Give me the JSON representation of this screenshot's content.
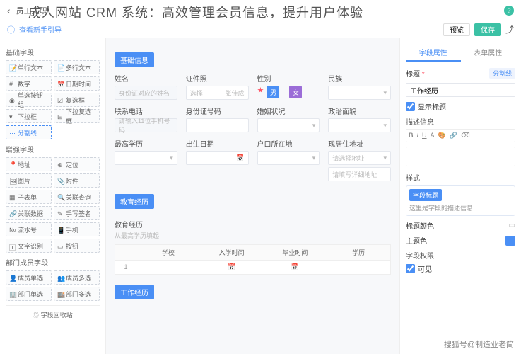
{
  "header": {
    "back_label": "员工入职",
    "title_overlay": "成人网站 CRM 系统：高效管理会员信息，提升用户体验"
  },
  "subbar": {
    "hint": "查看新手引导",
    "btn_view": "预览",
    "btn_save": "保存"
  },
  "leftPanel": {
    "basic": {
      "title": "基础字段",
      "items": [
        "单行文本",
        "多行文本",
        "数字",
        "日期时间",
        "单选按钮组",
        "复选框",
        "下拉框",
        "下拉复选框",
        "分割线"
      ]
    },
    "enhance": {
      "title": "增强字段",
      "items": [
        "地址",
        "定位",
        "图片",
        "附件",
        "子表单",
        "关联查询",
        "关联数据",
        "手写签名",
        "流水号",
        "手机",
        "文字识别",
        "按钮"
      ]
    },
    "dept": {
      "title": "部门成员字段",
      "items": [
        "成员单选",
        "成员多选",
        "部门单选",
        "部门多选"
      ]
    },
    "recycle": "字段回收站"
  },
  "center": {
    "sec_basic": "基础信息",
    "fields": {
      "name": {
        "label": "姓名",
        "ph": "身份证对应的姓名"
      },
      "cert": {
        "label": "证件照",
        "ph": "选择",
        "ph2": "张佳成"
      },
      "gender": {
        "label": "性别",
        "male": "男",
        "female": "女"
      },
      "nation": {
        "label": "民族"
      },
      "phone": {
        "label": "联系电话",
        "ph": "请输入11位手机号码"
      },
      "idnum": {
        "label": "身份证号码"
      },
      "marriage": {
        "label": "婚姻状况"
      },
      "politics": {
        "label": "政治面貌"
      },
      "edu": {
        "label": "最高学历"
      },
      "birth": {
        "label": "出生日期"
      },
      "hukou": {
        "label": "户口所在地"
      },
      "addr": {
        "label": "现居住地址",
        "ph1": "请选择地址",
        "ph2": "请填写详细地址"
      }
    },
    "sec_edu": "教育经历",
    "edu_table": {
      "title": "教育经历",
      "sub": "从最高学历填起",
      "cols": [
        "",
        "学校",
        "入学时间",
        "毕业时间",
        "学历"
      ],
      "row": [
        "1",
        "",
        "",
        ""
      ]
    },
    "sec_work": "工作经历"
  },
  "right": {
    "tabs": [
      "字段属性",
      "表单属性"
    ],
    "title_label": "标题",
    "title_val": "工作经历",
    "divider": "分割线",
    "show_title": "显示标题",
    "desc_label": "描述信息",
    "style_label": "样式",
    "style_hdr": "字段标题",
    "style_txt": "这里是字段的描述信息",
    "title_color": "标题颜色",
    "theme_color": "主题色",
    "perm_label": "字段权限",
    "visible": "可见"
  },
  "watermark": "搜狐号@制造业老简"
}
